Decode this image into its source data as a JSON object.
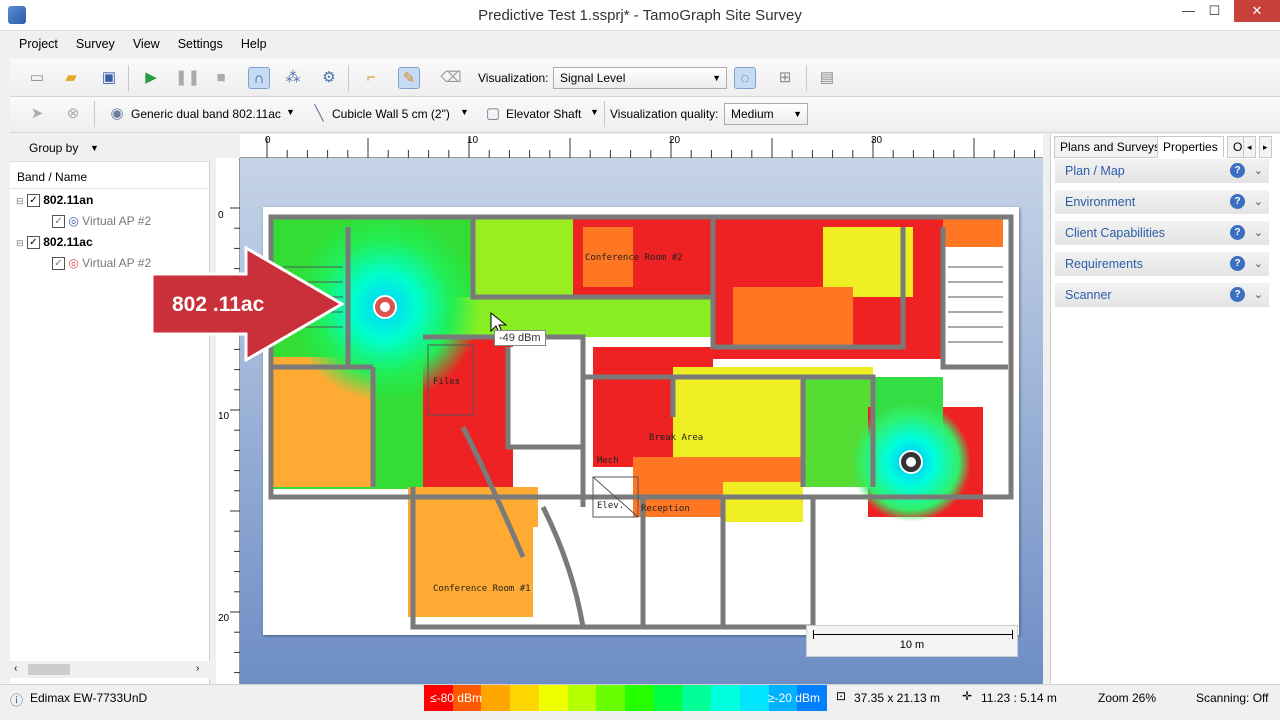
{
  "window": {
    "title": "Predictive Test 1.ssprj* - TamoGraph Site Survey",
    "minimize": "—",
    "maximize": "☐",
    "close": "✕"
  },
  "menu": [
    "Project",
    "Survey",
    "View",
    "Settings",
    "Help"
  ],
  "toolbar1": {
    "visualization_label": "Visualization:",
    "visualization_value": "Signal Level"
  },
  "toolbar2": {
    "ap_model": "Generic dual band 802.11ac",
    "wall_type": "Cubicle Wall 5 cm (2\")",
    "elevator": "Elevator Shaft",
    "quality_label": "Visualization quality:",
    "quality_value": "Medium"
  },
  "leftpanel": {
    "group_by": "Group by",
    "column_header": "Band / Name",
    "tree": [
      {
        "label": "802.11an",
        "child": "Virtual AP #2"
      },
      {
        "label": "802.11ac",
        "child": "Virtual AP #2"
      }
    ]
  },
  "ruler": {
    "top": [
      "0",
      "10",
      "20",
      "30"
    ],
    "left": [
      "0",
      "10",
      "20"
    ]
  },
  "map": {
    "rooms": [
      "Conference Room #2",
      "Files",
      "Break Area",
      "Mech",
      "Elev.",
      "Reception",
      "Conference Room #1"
    ],
    "tooltip": "-49 dBm",
    "callout": "802 .11ac",
    "scale": "10 m"
  },
  "rightpanel": {
    "tabs": [
      "Plans and Surveys",
      "Properties",
      "O"
    ],
    "sections": [
      "Plan / Map",
      "Environment",
      "Client Capabilities",
      "Requirements",
      "Scanner"
    ]
  },
  "status": {
    "adapter": "Edimax EW-7733UnD",
    "legend_min": "≤-80 dBm",
    "legend_max": "≥-20 dBm",
    "legend_colors": [
      "#ff0000",
      "#ff5a00",
      "#ffa500",
      "#ffd700",
      "#eeff00",
      "#b5ff00",
      "#6aff00",
      "#25ff00",
      "#00ff44",
      "#00ff99",
      "#00ffdd",
      "#00e5ff",
      "#00b2ff",
      "#0080ff"
    ],
    "dimensions": "37.35 x 21.13 m",
    "cursor": "11.23 : 5.14 m",
    "zoom": "Zoom 26%",
    "scanning": "Scanning: Off"
  }
}
